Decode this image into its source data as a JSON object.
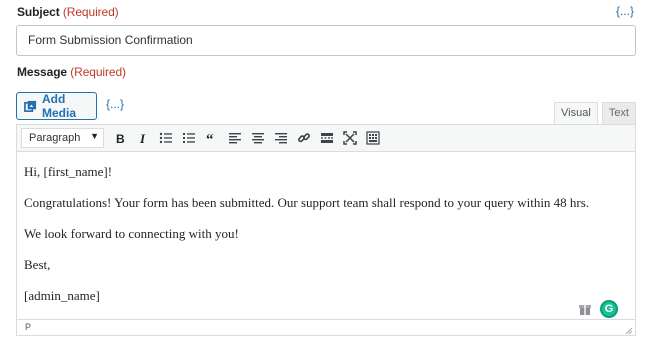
{
  "subject": {
    "label": "Subject",
    "required": "(Required)",
    "merge_tag": "{...}",
    "value": "Form Submission Confirmation"
  },
  "message": {
    "label": "Message",
    "required": "(Required)",
    "add_media_label": "Add Media",
    "merge_tag": "{...}",
    "tabs": [
      {
        "label": "Visual",
        "active": true
      },
      {
        "label": "Text",
        "active": false
      }
    ],
    "format_select": "Paragraph",
    "toolbar_icons": [
      "bold-icon",
      "italic-icon",
      "bulleted-list-icon",
      "numbered-list-icon",
      "blockquote-icon",
      "align-left-icon",
      "align-center-icon",
      "align-right-icon",
      "link-icon",
      "read-more-icon",
      "fullscreen-icon",
      "toolbar-toggle-icon"
    ],
    "body": [
      "Hi, [first_name]!",
      "Congratulations! Your form has been submitted. Our support team shall respond to your query within 48 hrs.",
      "We look forward to connecting with you!",
      "Best,",
      "[admin_name]"
    ],
    "status_path": "P"
  },
  "colors": {
    "accent": "#2271b1",
    "required": "#c0392b",
    "grammarly": "#15c39a"
  }
}
